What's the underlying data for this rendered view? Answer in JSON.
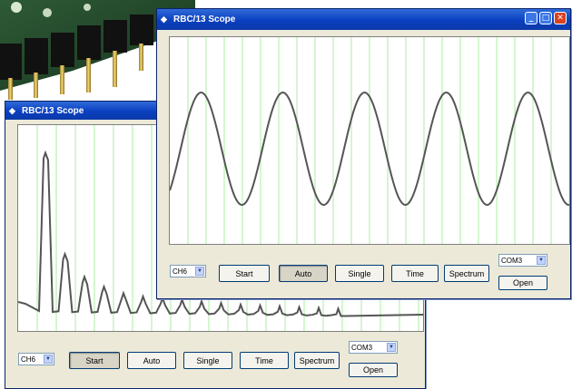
{
  "background_photo": {
    "subject": "pcb-with-header-pins"
  },
  "colors": {
    "grid": "#b9f0b0",
    "trace": "#555555",
    "title_start": "#2f6bd8",
    "title_end": "#0b3aa8",
    "window": "#ece9d8"
  },
  "back_window": {
    "title": "RBC/13 Scope",
    "channel_select": "CH6",
    "port_select": "COM3",
    "buttons": {
      "start": "Start",
      "auto": "Auto",
      "single": "Single",
      "time": "Time",
      "spectrum": "Spectrum",
      "open": "Open"
    },
    "pressed": "Start"
  },
  "front_window": {
    "title": "RBC/13 Scope",
    "channel_select": "CH6",
    "port_select": "COM3",
    "buttons": {
      "start": "Start",
      "auto": "Auto",
      "single": "Single",
      "time": "Time",
      "spectrum": "Spectrum",
      "open": "Open"
    },
    "pressed": "Auto",
    "controls": {
      "minimize": "minimize-icon",
      "maximize": "maximize-icon",
      "close": "close-icon"
    }
  },
  "traces": {
    "spectrum_peaks": [
      0.98,
      0.36,
      0.22,
      0.16,
      0.12,
      0.1,
      0.09,
      0.08,
      0.07,
      0.06,
      0.05,
      0.045,
      0.04,
      0.035,
      0.03,
      0.025
    ],
    "sine_cycles": 5
  }
}
